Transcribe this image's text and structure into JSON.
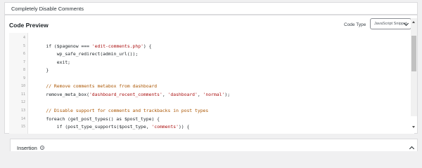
{
  "title_field": {
    "value": "Completely Disable Comments"
  },
  "code_preview": {
    "heading": "Code Preview",
    "code_type_label": "Code Type",
    "code_type_selected": "JavaScript Snippet"
  },
  "editor": {
    "lines": [
      {
        "num": "4",
        "tokens": []
      },
      {
        "num": "5",
        "tokens": [
          {
            "t": "    if ($pagenow === ",
            "c": ""
          },
          {
            "t": "'edit-comments.php'",
            "c": "str"
          },
          {
            "t": ") {",
            "c": ""
          }
        ]
      },
      {
        "num": "6",
        "tokens": [
          {
            "t": "        wp_safe_redirect(admin_url());",
            "c": ""
          }
        ]
      },
      {
        "num": "7",
        "tokens": [
          {
            "t": "        exit;",
            "c": ""
          }
        ]
      },
      {
        "num": "8",
        "tokens": [
          {
            "t": "    }",
            "c": ""
          }
        ]
      },
      {
        "num": "9",
        "tokens": []
      },
      {
        "num": "10",
        "tokens": [
          {
            "t": "    // Remove comments metabox from dashboard",
            "c": "cmt"
          }
        ]
      },
      {
        "num": "11",
        "tokens": [
          {
            "t": "    remove_meta_box(",
            "c": ""
          },
          {
            "t": "'dashboard_recent_comments'",
            "c": "str"
          },
          {
            "t": ", ",
            "c": ""
          },
          {
            "t": "'dashboard'",
            "c": "str"
          },
          {
            "t": ", ",
            "c": ""
          },
          {
            "t": "'normal'",
            "c": "str"
          },
          {
            "t": ");",
            "c": ""
          }
        ]
      },
      {
        "num": "12",
        "tokens": []
      },
      {
        "num": "13",
        "tokens": [
          {
            "t": "    // Disable support for comments and trackbacks in post types",
            "c": "cmt"
          }
        ]
      },
      {
        "num": "14",
        "tokens": [
          {
            "t": "    foreach (get_post_types() as $post_type) {",
            "c": ""
          }
        ]
      },
      {
        "num": "15",
        "tokens": [
          {
            "t": "        if (post_type_supports($post_type, ",
            "c": ""
          },
          {
            "t": "'comments'",
            "c": "str"
          },
          {
            "t": ")) {",
            "c": ""
          }
        ]
      }
    ]
  },
  "insertion": {
    "title": "Insertion",
    "help_glyph": "?"
  }
}
